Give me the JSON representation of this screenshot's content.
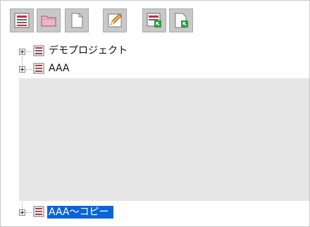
{
  "toolbar": {
    "buttons": [
      {
        "name": "project-list-icon"
      },
      {
        "name": "folder-icon"
      },
      {
        "name": "new-file-icon"
      },
      {
        "name": "edit-icon"
      },
      {
        "name": "import-project-icon"
      },
      {
        "name": "import-file-icon"
      }
    ]
  },
  "tree": {
    "nodes": [
      {
        "label": "デモプロジェクト"
      },
      {
        "label": "AAA"
      },
      {
        "label": "AAA～コピー",
        "selected": true
      }
    ]
  },
  "colors": {
    "selection": "#0a64d6",
    "panel": "#e6e6e6",
    "toolbar_button": "#c8c8c8"
  }
}
